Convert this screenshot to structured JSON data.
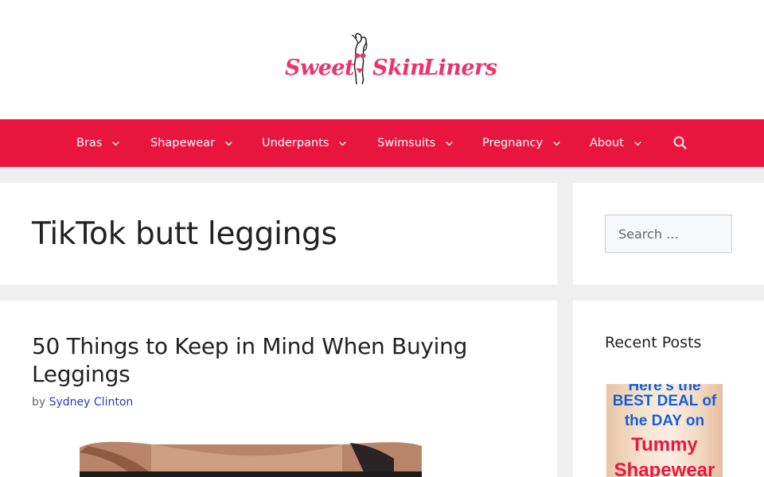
{
  "header": {
    "logo_words": [
      "Sweet",
      "Skin",
      "Liners"
    ]
  },
  "nav": {
    "items": [
      {
        "label": "Bras"
      },
      {
        "label": "Shapewear"
      },
      {
        "label": "Underpants"
      },
      {
        "label": "Swimsuits"
      },
      {
        "label": "Pregnancy"
      },
      {
        "label": "About"
      }
    ],
    "search_icon": "search-icon",
    "dropdown_icon": "chevron-down-icon"
  },
  "page": {
    "title": "TikTok butt leggings"
  },
  "article": {
    "title": "50 Things to Keep in Mind When Buying Leggings",
    "by_prefix": "by",
    "author": "Sydney Clinton"
  },
  "sidebar": {
    "search_placeholder": "Search …",
    "recent_title": "Recent Posts",
    "thumb_lines": [
      "Here's the",
      "BEST DEAL of",
      "the DAY on",
      "Tummy",
      "Shapewear"
    ]
  },
  "colors": {
    "nav_bg": "#e8163f",
    "logo_pink": "#e8366a",
    "link_blue": "#1e3fb8",
    "thumb_blue": "#1560d6",
    "thumb_red": "#e8163f"
  }
}
